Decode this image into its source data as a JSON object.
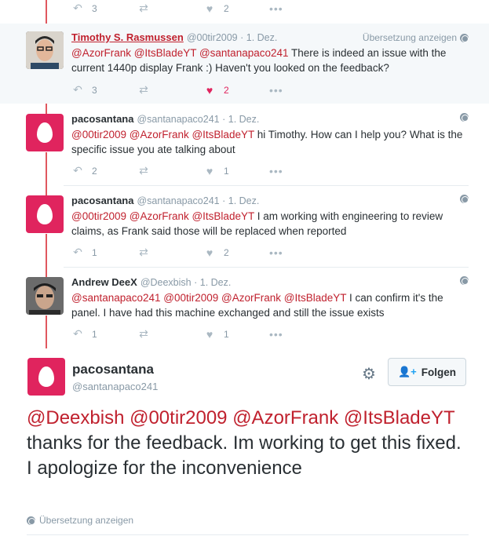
{
  "colors": {
    "accent": "#e0245e",
    "mention": "#c0212e",
    "muted": "#8899a6",
    "thread": "#e0575f"
  },
  "top_actions": {
    "reply_count": "3",
    "like_count": "2"
  },
  "tweets": [
    {
      "name": "Timothy S. Rasmussen",
      "handle": "@00tir2009",
      "time": "· 1. Dez.",
      "translate_label": "Übersetzung anzeigen",
      "mentions": "@AzorFrank @ItsBladeYT @santanapaco241",
      "text": " There is indeed an issue with the current 1440p display Frank :) Haven't you looked on the feedback?",
      "reply_count": "3",
      "like_count": "2",
      "liked": true
    },
    {
      "name": "pacosantana",
      "handle": "@santanapaco241",
      "time": "· 1. Dez.",
      "mentions": "@00tir2009 @AzorFrank @ItsBladeYT",
      "text": " hi Timothy.  How can I help you? What is the specific issue you ate talking about",
      "reply_count": "2",
      "like_count": "1"
    },
    {
      "name": "pacosantana",
      "handle": "@santanapaco241",
      "time": "· 1. Dez.",
      "mentions": "@00tir2009 @AzorFrank @ItsBladeYT",
      "text": " I am working with engineering to review claims, as Frank said those will be replaced when reported",
      "reply_count": "1",
      "like_count": "2"
    },
    {
      "name": "Andrew DeeX",
      "handle": "@Deexbish",
      "time": "· 1. Dez.",
      "mentions": "@santanapaco241 @00tir2009 @AzorFrank @ItsBladeYT",
      "text": " I can confirm it's the panel. I have had this machine exchanged and still the issue exists",
      "reply_count": "1",
      "like_count": "1"
    }
  ],
  "main_tweet": {
    "name": "pacosantana",
    "handle": "@santanapaco241",
    "follow_label": "Folgen",
    "mentions": "@Deexbish @00tir2009 @AzorFrank @ItsBladeYT",
    "text": "  thanks for the feedback.  Im working to get this fixed.  I apologize for the inconvenience",
    "translate_label": "Übersetzung anzeigen"
  },
  "icons": {
    "reply": "reply-icon",
    "retweet": "retweet-icon",
    "like": "heart-icon",
    "more": "more-icon",
    "globe": "globe-icon",
    "gear": "gear-icon",
    "follow": "add-user-icon"
  }
}
